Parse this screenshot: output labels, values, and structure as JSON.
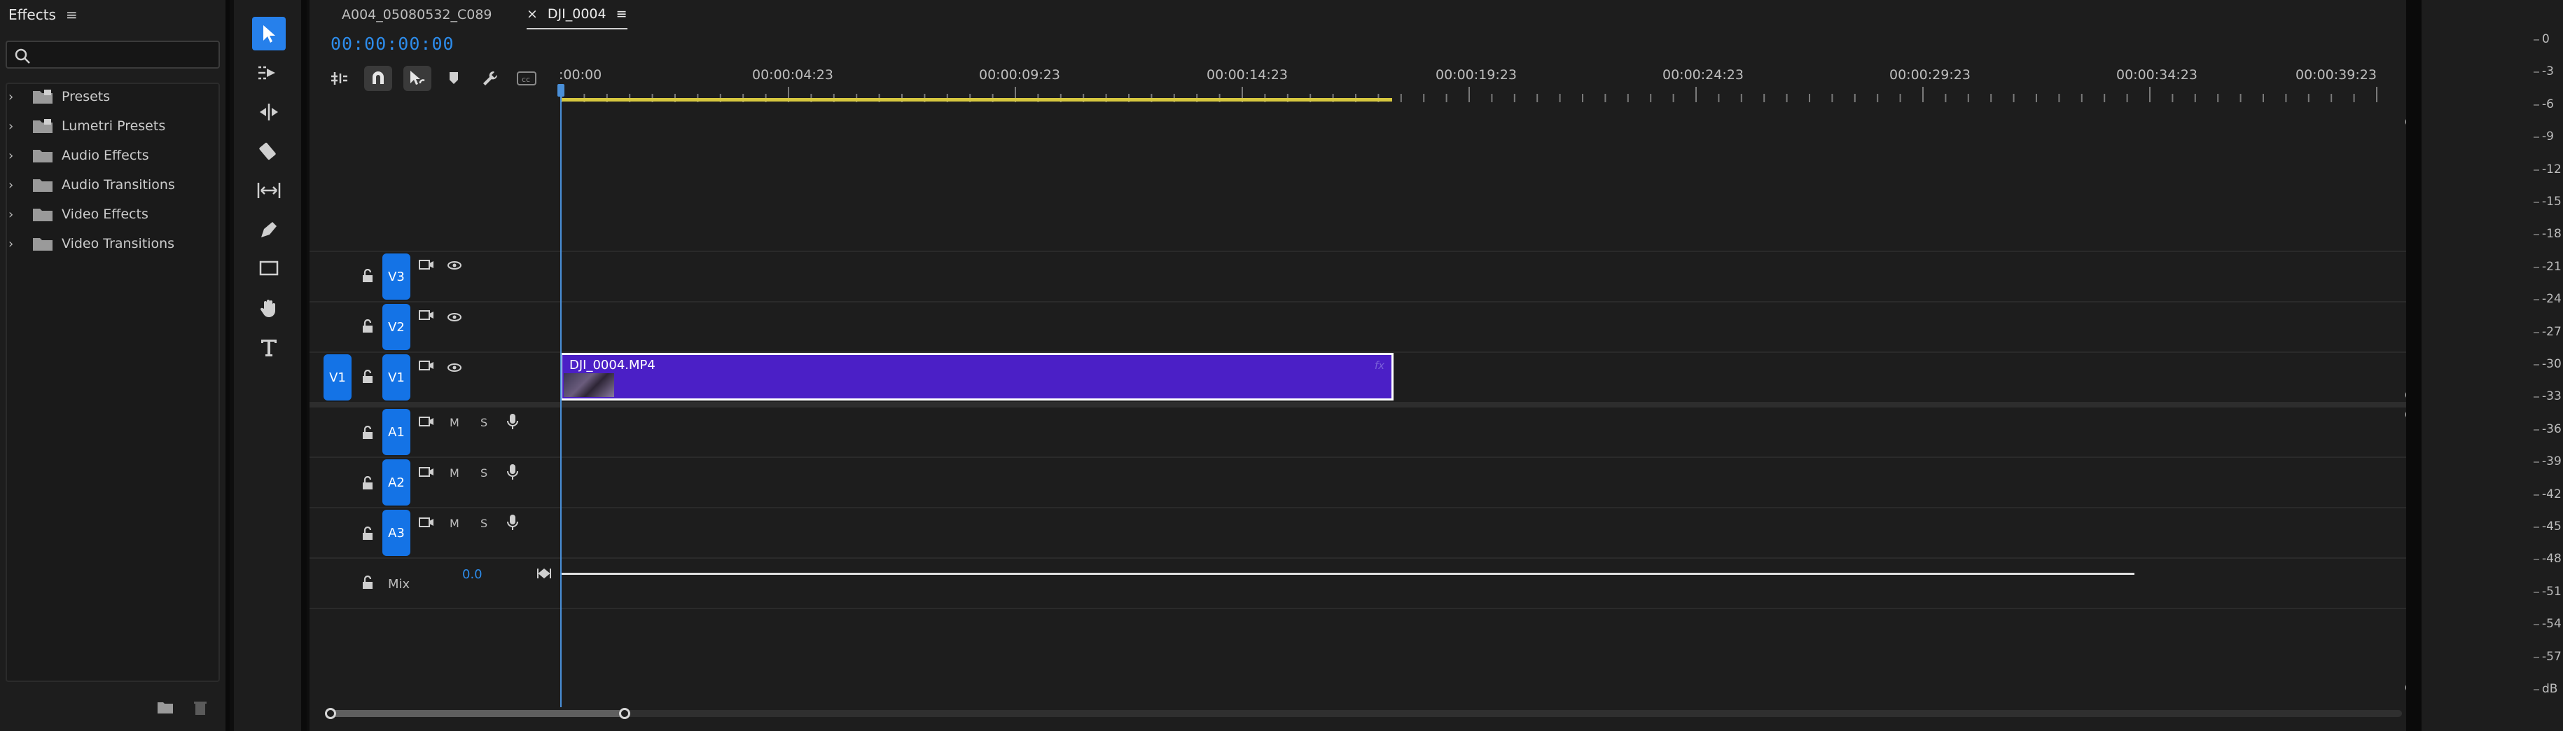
{
  "effects_panel": {
    "title": "Effects",
    "menu_icon": "hamburger-icon",
    "search": {
      "placeholder": "",
      "value": ""
    },
    "items": [
      {
        "label": "Presets",
        "icon": "preset-folder-icon"
      },
      {
        "label": "Lumetri Presets",
        "icon": "preset-folder-icon"
      },
      {
        "label": "Audio Effects",
        "icon": "folder-icon"
      },
      {
        "label": "Audio Transitions",
        "icon": "folder-icon"
      },
      {
        "label": "Video Effects",
        "icon": "folder-icon"
      },
      {
        "label": "Video Transitions",
        "icon": "folder-icon"
      }
    ]
  },
  "tools": [
    {
      "name": "selection-tool",
      "active": true
    },
    {
      "name": "track-select-forward-tool",
      "active": false
    },
    {
      "name": "ripple-edit-tool",
      "active": false
    },
    {
      "name": "razor-tool",
      "active": false
    },
    {
      "name": "slip-tool",
      "active": false
    },
    {
      "name": "pen-tool",
      "active": false
    },
    {
      "name": "rectangle-tool",
      "active": false
    },
    {
      "name": "hand-tool",
      "active": false
    },
    {
      "name": "type-tool",
      "active": false
    }
  ],
  "timeline": {
    "tabs": [
      {
        "label": "A004_05080532_C089",
        "active": false
      },
      {
        "label": "DJI_0004",
        "active": true,
        "close": "×",
        "menu": "≡"
      }
    ],
    "timecode": "00:00:00:00",
    "ruler_labels": [
      ":00:00",
      "00:00:04:23",
      "00:00:09:23",
      "00:00:14:23",
      "00:00:19:23",
      "00:00:24:23",
      "00:00:29:23",
      "00:00:34:23",
      "00:00:39:23"
    ],
    "video_tracks": [
      {
        "label": "V3"
      },
      {
        "label": "V2"
      },
      {
        "label": "V1",
        "source_patch": "V1"
      }
    ],
    "audio_tracks": [
      {
        "label": "A1",
        "mute": "M",
        "solo": "S"
      },
      {
        "label": "A2",
        "mute": "M",
        "solo": "S"
      },
      {
        "label": "A3",
        "mute": "M",
        "solo": "S"
      }
    ],
    "mix": {
      "label": "Mix",
      "value": "0.0"
    },
    "clip": {
      "name": "DJI_0004.MP4",
      "fx": "fx"
    },
    "colors": {
      "accent": "#2680eb",
      "timecode": "#2d8ceb",
      "clip": "#4b1fc6",
      "work_area": "#d7c83f",
      "track_target": "#1473e6"
    }
  },
  "meters": {
    "db_labels": [
      "0",
      "-3",
      "-6",
      "-9",
      "-12",
      "-15",
      "-18",
      "-21",
      "-24",
      "-27",
      "-30",
      "-33",
      "-36",
      "-39",
      "-42",
      "-45",
      "-48",
      "-51",
      "-54",
      "-57",
      "dB"
    ]
  }
}
